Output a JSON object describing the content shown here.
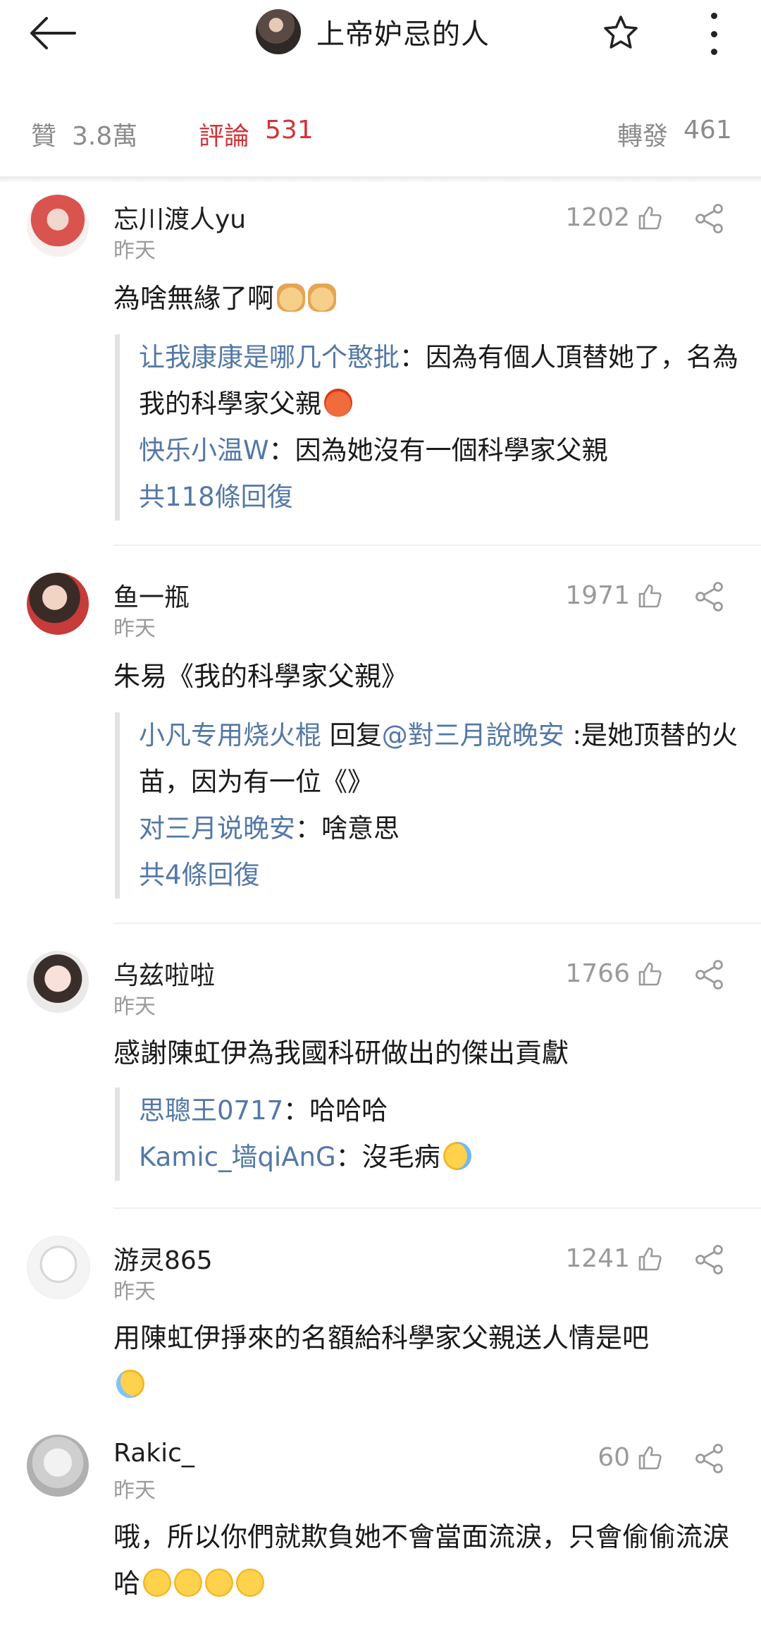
{
  "header": {
    "title": "上帝妒忌的人"
  },
  "stats": {
    "likes_label": "贊",
    "likes_value": "3.8萬",
    "comments_label": "評論",
    "comments_value": "531",
    "reposts_label": "轉發",
    "reposts_value": "461"
  },
  "comments": [
    {
      "user": "忘川渡人yu",
      "time": "昨天",
      "likes": "1202",
      "text": "為啥無緣了啊",
      "replies": [
        {
          "name": "让我康康是哪几个憨批",
          "text": "：因為有個人頂替她了，名為我的科學家父親"
        },
        {
          "name": "快乐小温W",
          "text": "：因為她沒有一個科學家父親"
        }
      ],
      "more": "共118條回復"
    },
    {
      "user": "鱼一瓶",
      "time": "昨天",
      "likes": "1971",
      "text": "朱易《我的科學家父親》",
      "replies": [
        {
          "name": "小凡专用烧火棍",
          "mid": " 回复",
          "mention": "@對三月說晚安",
          "text": " :是她顶替的火苗，因为有一位《》"
        },
        {
          "name": "对三月说晚安",
          "text": "：啥意思"
        }
      ],
      "more": "共4條回復"
    },
    {
      "user": "乌兹啦啦",
      "time": "昨天",
      "likes": "1766",
      "text": "感謝陳虹伊為我國科研做出的傑出貢獻",
      "replies": [
        {
          "name": "思聰王0717",
          "text": "：哈哈哈"
        },
        {
          "name": "Kamic_墙qiAnG",
          "text": "：沒毛病"
        }
      ]
    },
    {
      "user": "游灵865",
      "time": "昨天",
      "likes": "1241",
      "text": "用陳虹伊掙來的名額給科學家父親送人情是吧"
    },
    {
      "user": "Rakic_",
      "time": "昨天",
      "likes": "60",
      "text": "哦，所以你們就欺負她不會當面流淚，只會偷偷流淚哈"
    }
  ]
}
